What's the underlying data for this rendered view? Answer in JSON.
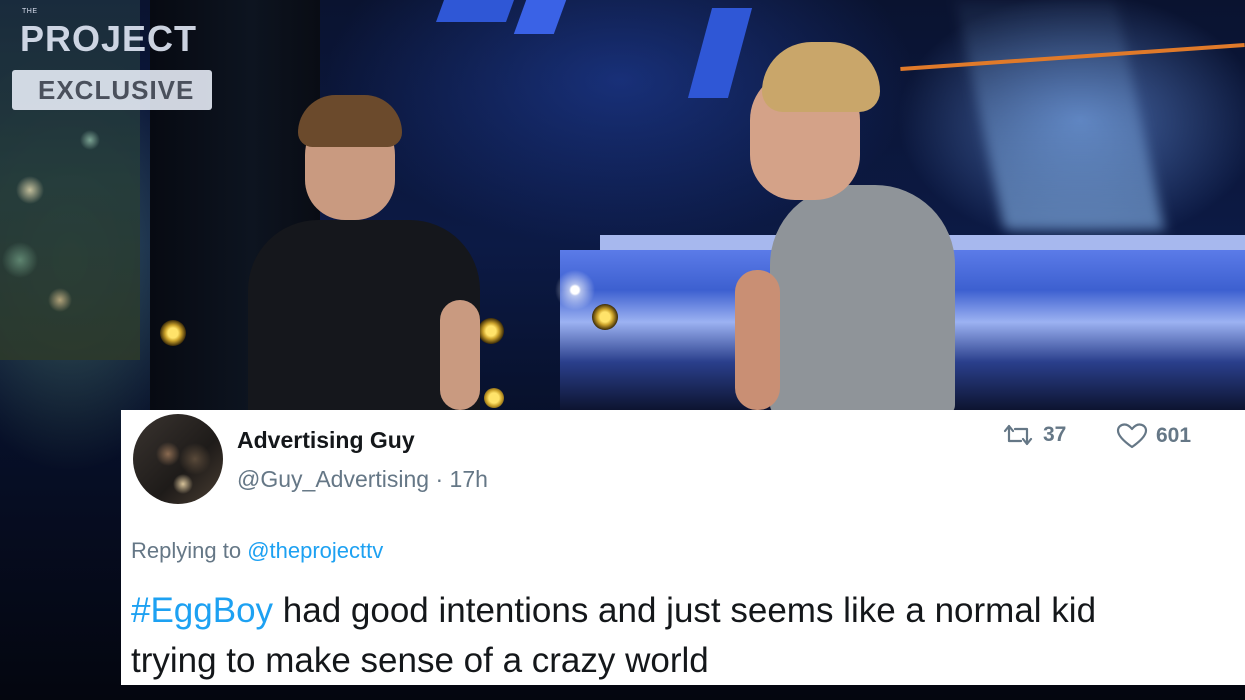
{
  "video": {
    "logo": {
      "small_text": "THE",
      "title": "PROJECT",
      "badge": "EXCLUSIVE"
    }
  },
  "tweet": {
    "author_name": "Advertising Guy",
    "handle_line": "@Guy_Advertising · 17h",
    "retweet_count": "37",
    "like_count": "601",
    "replying_prefix": "Replying to",
    "replying_to": "@theprojecttv",
    "hashtag": "#EggBoy",
    "text_line1_rest": " had good intentions and just seems like a normal kid",
    "text_line2": "trying to make sense of a crazy world"
  },
  "colors": {
    "link_blue": "#1da1f2",
    "muted_gray": "#657786",
    "text_dark": "#14171a",
    "card_bg": "#ffffff"
  },
  "icons": {
    "retweet": "retweet-icon",
    "like": "heart-icon"
  }
}
